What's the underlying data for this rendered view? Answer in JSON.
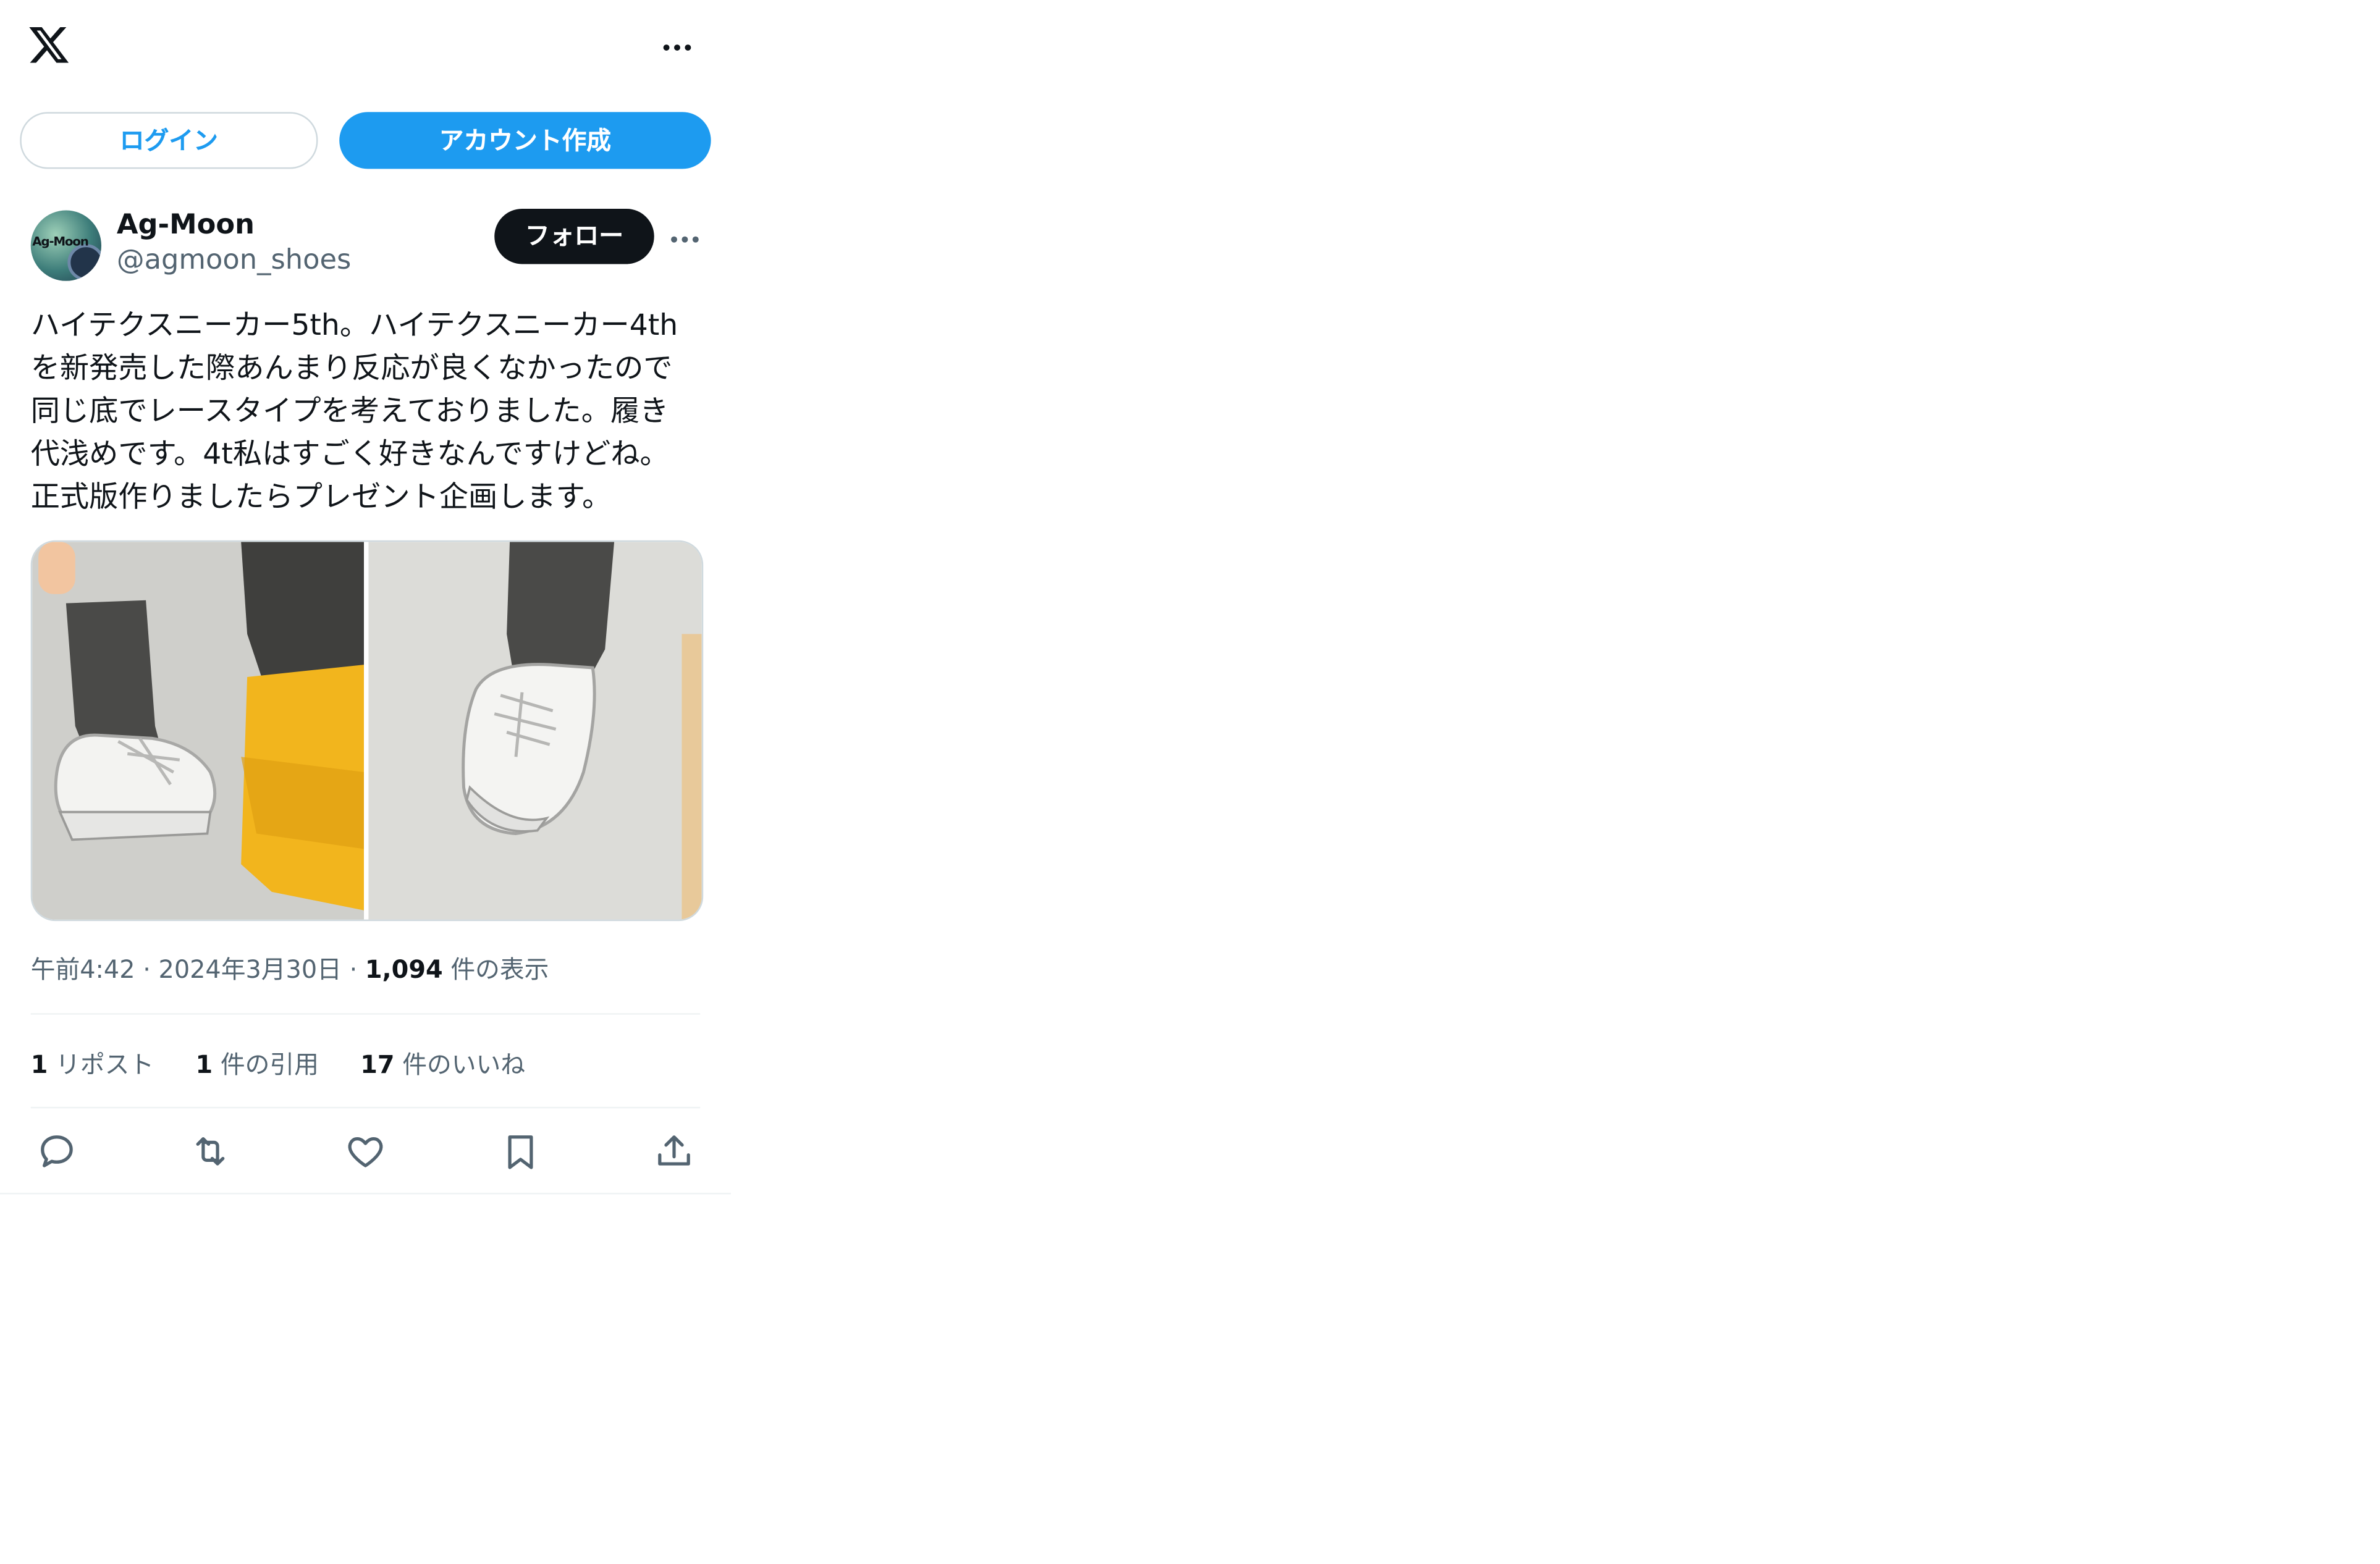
{
  "header": {
    "logo_icon": "x-logo-icon",
    "more_icon": "more-horizontal-icon"
  },
  "auth": {
    "login_label": "ログイン",
    "signup_label": "アカウント作成"
  },
  "tweet": {
    "author_name": "Ag-Moon",
    "author_handle": "@agmoon_shoes",
    "avatar_text": "Ag-Moon",
    "follow_label": "フォロー",
    "text": "ハイテクスニーカー5th。ハイテクスニーカー4th\nを新発売した際あんまり反応が良くなかったので\n同じ底でレースタイプを考えておりました。履き\n代浅めです。4t私はすごく好きなんですけどね。\n正式版作りましたらプレゼント企画します。",
    "time": "午前4:42",
    "separator": "·",
    "date": "2024年3月30日",
    "views_count": "1,094",
    "views_label": "件の表示",
    "stats": {
      "reposts_count": "1",
      "reposts_label": "リポスト",
      "quotes_count": "1",
      "quotes_label": "件の引用",
      "likes_count": "17",
      "likes_label": "件のいいね"
    },
    "actions": [
      "reply-icon",
      "retweet-icon",
      "like-icon",
      "bookmark-icon",
      "share-icon"
    ]
  },
  "colors": {
    "accent": "#1d9bf0",
    "text_primary": "#0f1419",
    "text_secondary": "#536471",
    "border": "#cfd9de"
  }
}
